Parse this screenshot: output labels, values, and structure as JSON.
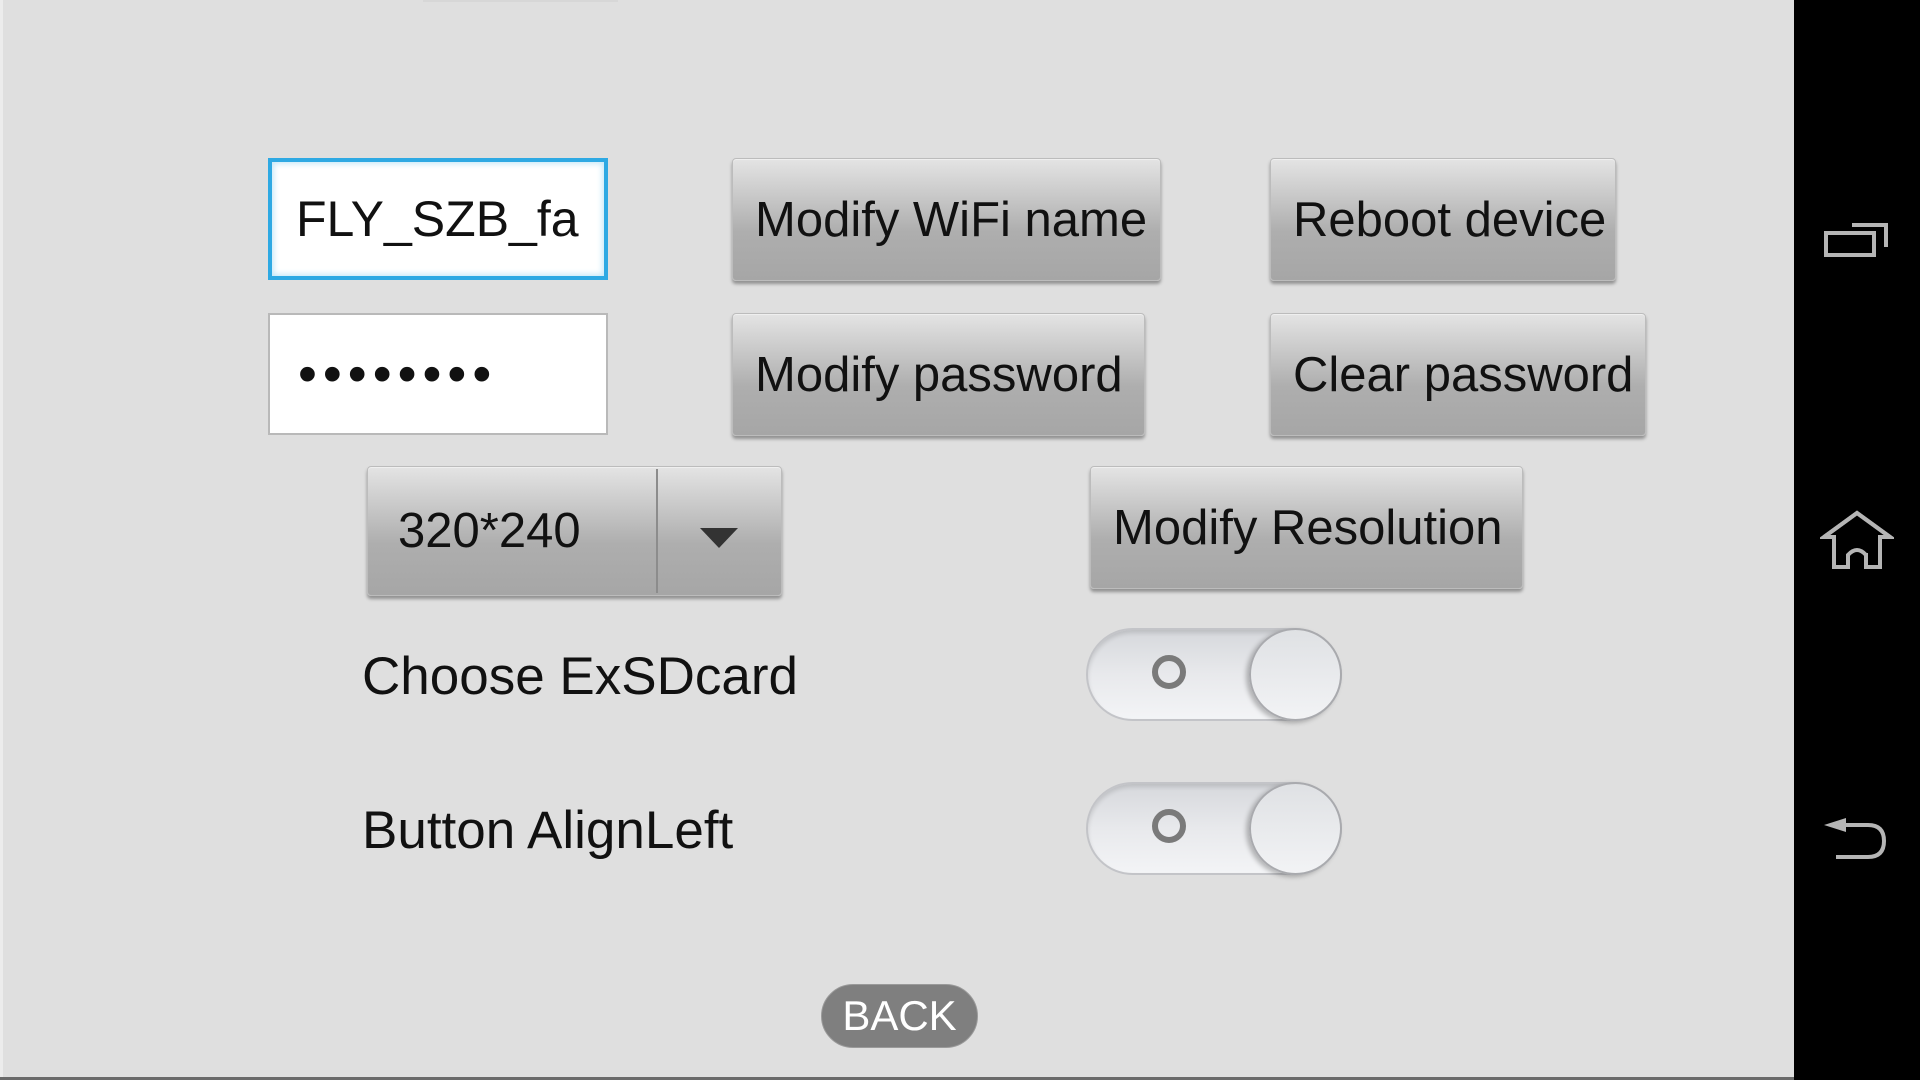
{
  "wifi": {
    "name_value": "FLY_SZB_fa",
    "password_value": "••••••••",
    "modify_name_label": "Modify WiFi name",
    "modify_password_label": "Modify password",
    "reboot_label": "Reboot device",
    "clear_password_label": "Clear password"
  },
  "resolution": {
    "selected": "320*240",
    "modify_label": "Modify Resolution"
  },
  "settings": [
    {
      "label": "Choose ExSDcard",
      "state": "off"
    },
    {
      "label": "Button AlignLeft",
      "state": "off"
    }
  ],
  "footer": {
    "back_label": "BACK"
  },
  "navbar": {
    "icons": [
      "recent-apps-icon",
      "home-icon",
      "back-icon"
    ]
  },
  "colors": {
    "focus_accent": "#2ea9e3",
    "background": "#dfdfdf",
    "navbar": "#000000",
    "nav_icon": "#b5b5b5"
  }
}
